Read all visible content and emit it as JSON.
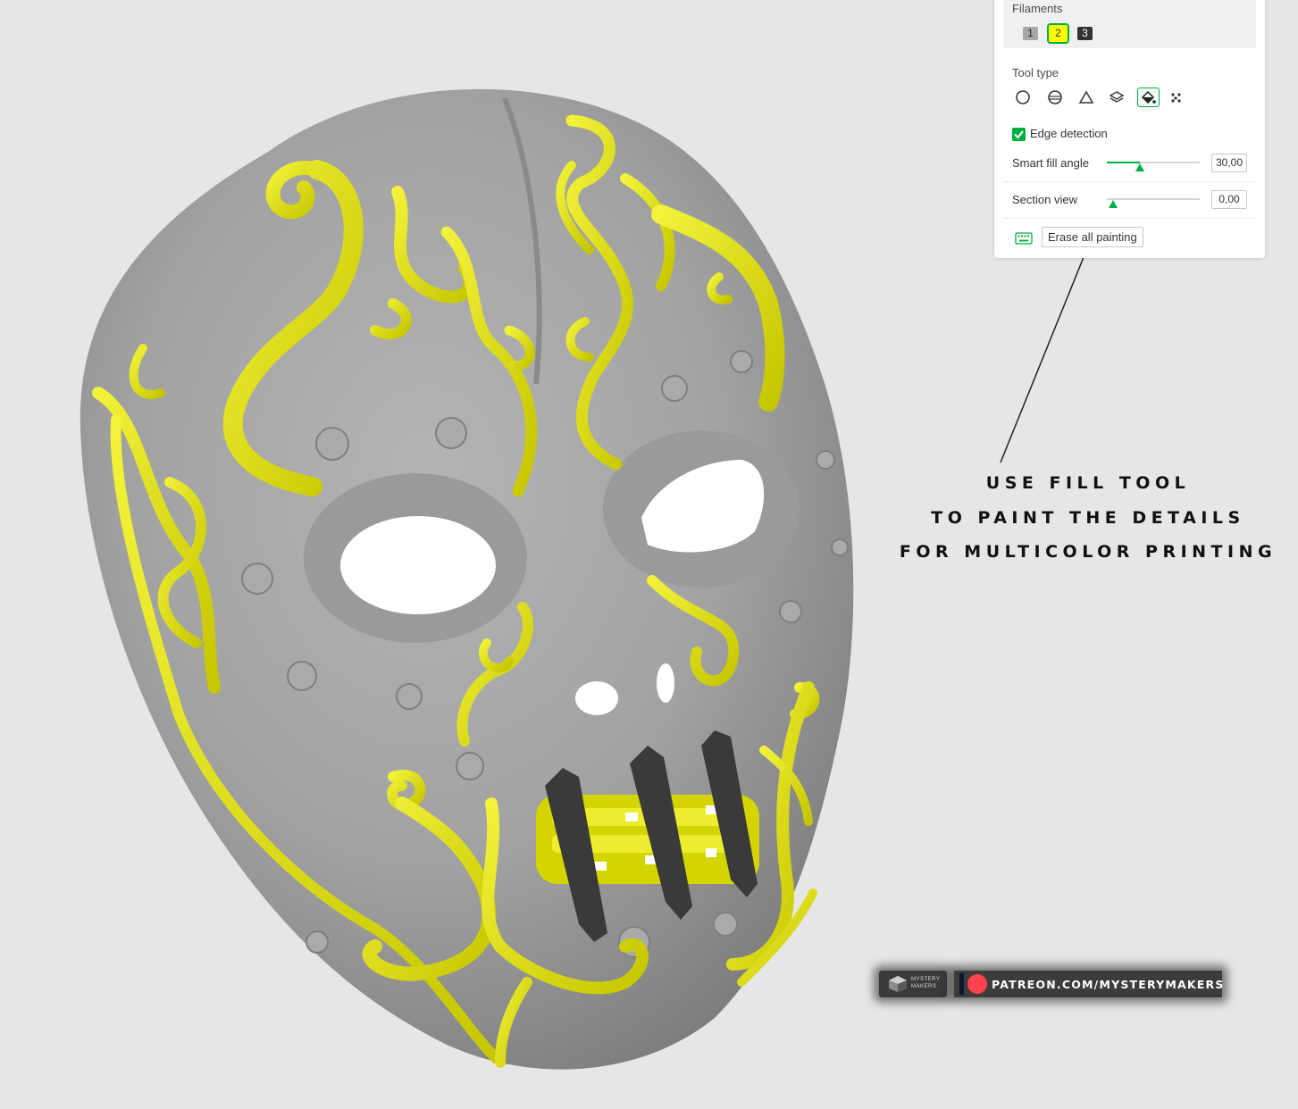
{
  "panel": {
    "filaments_label": "Filaments",
    "filaments": [
      {
        "label": "1",
        "color": "#a8a8a8"
      },
      {
        "label": "2",
        "color": "#ffff00",
        "selected": true
      },
      {
        "label": "3",
        "color": "#333333"
      }
    ],
    "tool_type_label": "Tool type",
    "tools": [
      {
        "name": "circle-icon"
      },
      {
        "name": "sphere-icon"
      },
      {
        "name": "triangle-icon"
      },
      {
        "name": "height-range-icon"
      },
      {
        "name": "fill-bucket-icon",
        "active": true
      },
      {
        "name": "gap-fill-icon"
      }
    ],
    "edge_detection_label": "Edge detection",
    "edge_detection_checked": true,
    "smart_fill_label": "Smart fill angle",
    "smart_fill_value": "30,00",
    "smart_fill_fraction": 0.36,
    "section_view_label": "Section view",
    "section_view_value": "0,00",
    "section_view_fraction": 0.0,
    "erase_label": "Erase all painting",
    "accent_color": "#00ae42"
  },
  "annotation": {
    "line1": "USE FILL TOOL",
    "line2": "TO PAINT THE DETAILS",
    "line3": "FOR MULTICOLOR PRINTING"
  },
  "brand": {
    "logo_line1": "MYSTERY",
    "logo_line2": "MAKERS",
    "patreon_url": "PATREON.COM/MYSTERYMAKERS"
  },
  "model": {
    "base_color": "#9e9e9e",
    "detail_color": "#e5e500",
    "strap_color": "#3a3a3a"
  }
}
